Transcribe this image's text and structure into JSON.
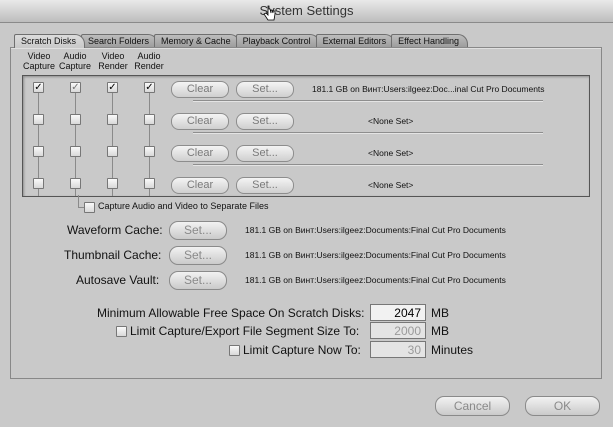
{
  "window": {
    "title": "System Settings"
  },
  "tabs": [
    {
      "label": "Scratch Disks"
    },
    {
      "label": "Search Folders"
    },
    {
      "label": "Memory & Cache"
    },
    {
      "label": "Playback Control"
    },
    {
      "label": "External Editors"
    },
    {
      "label": "Effect Handling"
    }
  ],
  "columns": {
    "video_capture": [
      "Video",
      "Capture"
    ],
    "audio_capture": [
      "Audio",
      "Capture"
    ],
    "video_render": [
      "Video",
      "Render"
    ],
    "audio_render": [
      "Audio",
      "Render"
    ]
  },
  "scratch_rows": [
    {
      "video_capture": true,
      "audio_capture": true,
      "video_render": true,
      "audio_render": true,
      "clear": "Clear",
      "set": "Set...",
      "path": "181.1 GB on  Винт:Users:ilgeez:Doc...inal Cut Pro Documents"
    },
    {
      "video_capture": false,
      "audio_capture": false,
      "video_render": false,
      "audio_render": false,
      "clear": "Clear",
      "set": "Set...",
      "path": "<None Set>"
    },
    {
      "video_capture": false,
      "audio_capture": false,
      "video_render": false,
      "audio_render": false,
      "clear": "Clear",
      "set": "Set...",
      "path": "<None Set>"
    },
    {
      "video_capture": false,
      "audio_capture": false,
      "video_render": false,
      "audio_render": false,
      "clear": "Clear",
      "set": "Set...",
      "path": "<None Set>"
    }
  ],
  "separate_files_label": "Capture Audio and Video to Separate Files",
  "caches": [
    {
      "label": "Waveform Cache:",
      "button": "Set...",
      "path": "181.1 GB on  Винт:Users:ilgeez:Documents:Final Cut Pro Documents"
    },
    {
      "label": "Thumbnail Cache:",
      "button": "Set...",
      "path": "181.1 GB on  Винт:Users:ilgeez:Documents:Final Cut Pro Documents"
    },
    {
      "label": "Autosave Vault:",
      "button": "Set...",
      "path": "181.1 GB on  Винт:Users:ilgeez:Documents:Final Cut Pro Documents"
    }
  ],
  "min_free": {
    "label": "Minimum Allowable Free Space On Scratch Disks:",
    "value": "2047",
    "unit": "MB"
  },
  "limit_segment": {
    "label": "Limit Capture/Export File Segment Size To:",
    "value": "2000",
    "unit": "MB"
  },
  "limit_capture": {
    "label": "Limit Capture Now To:",
    "value": "30",
    "unit": "Minutes"
  },
  "footer": {
    "cancel": "Cancel",
    "ok": "OK"
  }
}
